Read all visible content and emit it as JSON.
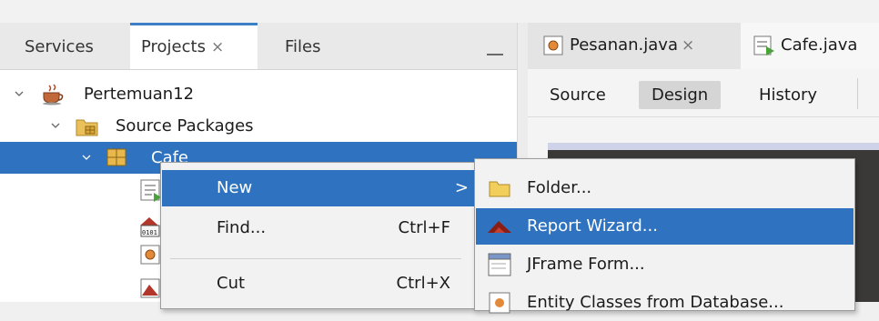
{
  "projects_panel": {
    "tabs": [
      {
        "label": "Services"
      },
      {
        "label": "Projects",
        "close": "×"
      },
      {
        "label": "Files"
      }
    ],
    "tree": [
      {
        "label": "Pertemuan12",
        "icon": "coffee-cup-project-icon"
      },
      {
        "label": "Source Packages",
        "icon": "source-packages-icon"
      },
      {
        "label": "Cafe",
        "icon": "package-icon"
      }
    ]
  },
  "editor": {
    "tabs": [
      {
        "label": "Pesanan.java",
        "close": "×"
      },
      {
        "label": "Cafe.java"
      }
    ],
    "views": [
      "Source",
      "Design",
      "History"
    ]
  },
  "context_menu": {
    "items": [
      {
        "label": "New",
        "shortcut": ">"
      },
      {
        "label": "Find...",
        "shortcut": "Ctrl+F"
      },
      {
        "label": "Cut",
        "shortcut": "Ctrl+X"
      }
    ]
  },
  "new_submenu": {
    "items": [
      {
        "label": "Folder...",
        "icon": "folder-icon"
      },
      {
        "label": "Report Wizard...",
        "icon": "report-wizard-icon"
      },
      {
        "label": "JFrame Form...",
        "icon": "jframe-icon"
      },
      {
        "label": "Entity Classes from Database...",
        "icon": "entity-class-icon"
      }
    ]
  },
  "colors": {
    "selection": "#2f73c0",
    "active_tab_accent": "#3d7fc4"
  }
}
